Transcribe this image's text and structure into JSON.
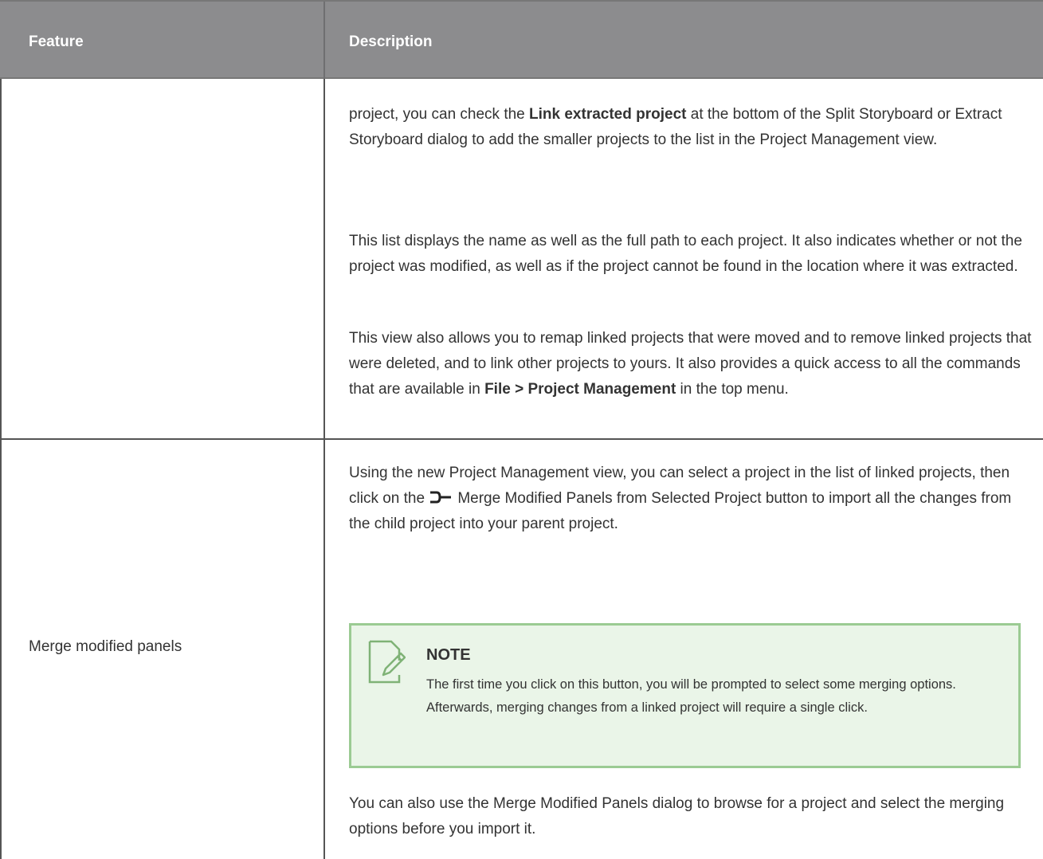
{
  "table": {
    "headers": {
      "feature": "Feature",
      "description": "Description"
    },
    "rows": [
      {
        "feature": "",
        "paragraphs": {
          "p1_a": "project, you can check the ",
          "p1_b": "Link extracted project",
          "p1_c": " at the bottom of the Split Storyboard or Extract Storyboard dialog to add the smaller projects to the list in the Project Management view.",
          "p2": "This list displays the name as well as the full path to each project. It also indicates whether or not the project was modified, as well as if the project cannot be found in the location where it was extracted.",
          "p3_a": "This view also allows you to remap linked projects that were moved and to remove linked projects that were deleted, and to link other projects to yours. It also provides a quick access to all the commands that are available in ",
          "p3_b": "File > Project Management",
          "p3_c": " in the top menu."
        }
      },
      {
        "feature": "Merge modified panels",
        "paragraphs": {
          "p1_a": "Using the new Project Management view, you can select a project in the list of linked projects, then click on the ",
          "p1_b": "Merge Modified Panels from Selected Project button to import all the changes from the child project into your parent project.",
          "icon": "merge-panels-icon",
          "note_title": "NOTE",
          "note_text": "The first time you click on this button, you will be prompted to select some merging options. Afterwards, merging changes from a linked project will require a single click.",
          "note_icon": "note-pencil-icon",
          "p2": "You can also use the Merge Modified Panels dialog to browse for a project and select the merging options before you import it."
        }
      }
    ]
  }
}
